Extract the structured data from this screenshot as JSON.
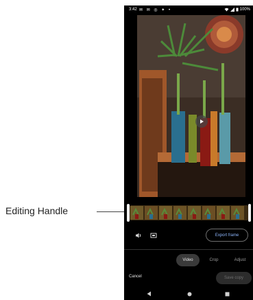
{
  "callout": {
    "label": "Editing Handle"
  },
  "status_bar": {
    "time": "3:42",
    "left_icons": "✉ ✉ ◎ ✦ •",
    "battery": "100%"
  },
  "editor": {
    "export_label": "Export frame",
    "tabs": [
      {
        "label": "Video",
        "active": true
      },
      {
        "label": "Crop",
        "active": false
      },
      {
        "label": "Adjust",
        "active": false
      }
    ],
    "cancel_label": "Cancel",
    "save_label": "Save copy"
  },
  "colors": {
    "accent": "#8fb8ff",
    "background": "#000000",
    "active_tab_bg": "#3a3a3a"
  },
  "icons": {
    "play": "play-icon",
    "volume": "volume-icon",
    "stabilize": "stabilize-icon",
    "nav_back": "back-triangle-icon",
    "nav_home": "home-dot-icon",
    "nav_recents": "recents-square-icon"
  }
}
